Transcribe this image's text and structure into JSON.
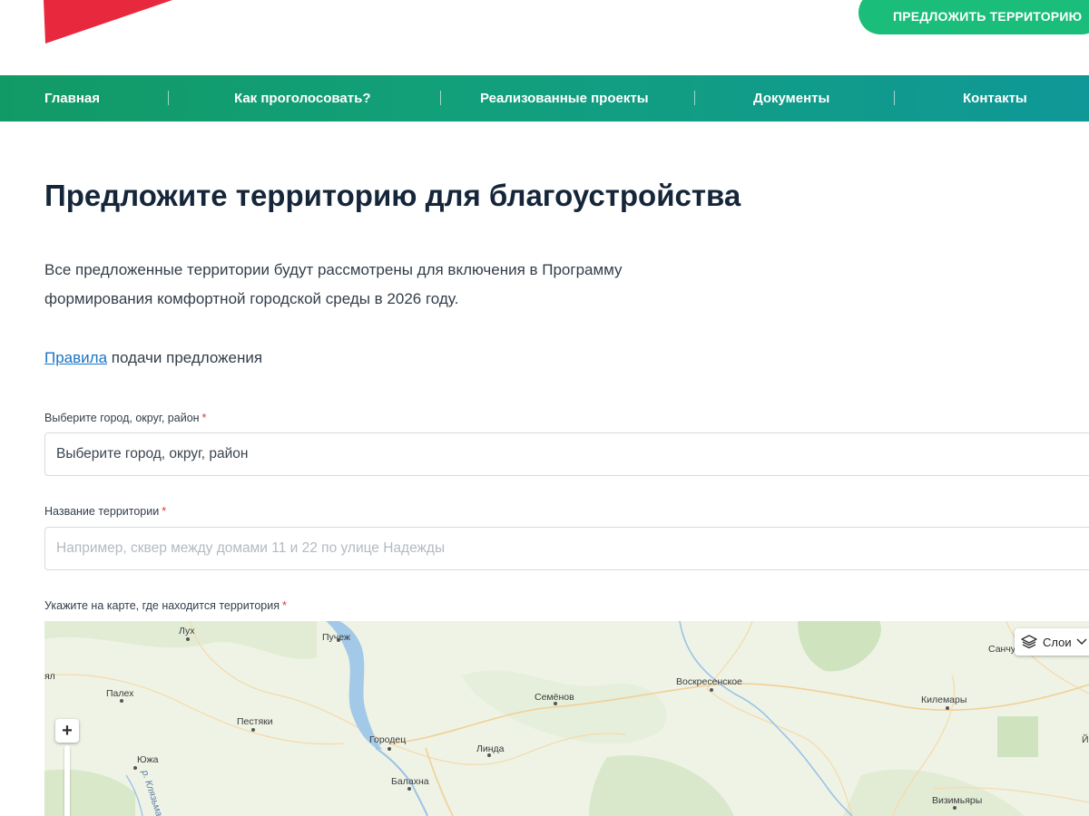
{
  "header": {
    "cta_label": "ПРЕДЛОЖИТЬ ТЕРРИТОРИЮ",
    "accent_color": "#1bbd7a",
    "logo_color": "#e8283c"
  },
  "nav": {
    "items": [
      {
        "label": "Главная"
      },
      {
        "label": "Как проголосовать?"
      },
      {
        "label": "Реализованные проекты"
      },
      {
        "label": "Документы"
      },
      {
        "label": "Контакты"
      }
    ],
    "gradient": [
      "#129a66",
      "#0f9897"
    ]
  },
  "main": {
    "title": "Предложите территорию для благоустройства",
    "intro_line1": "Все предложенные территории будут рассмотрены для включения в Программу",
    "intro_line2": "формирования комфортной городской среды в 2026 году.",
    "rules_link": "Правила",
    "rules_rest": "подачи предложения"
  },
  "form": {
    "city_label": "Выберите город, округ, район",
    "city_value": "Выберите город, округ, район",
    "name_label": "Название территории",
    "name_placeholder": "Например, сквер между домами 11 и 22 по улице Надежды",
    "map_label": "Укажите на карте, где находится территория",
    "required_mark": "*"
  },
  "map": {
    "zoom_in": "+",
    "layers_label": "Слои",
    "layers_icon": "layers-icon",
    "places": {
      "lukh": "Лух",
      "puchezh": "Пучеж",
      "ya": "ял",
      "palekh": "Палех",
      "pestyaki": "Пестяки",
      "semenov": "Семёнов",
      "voskresenskoe": "Воскресенское",
      "kilemary": "Килемары",
      "sanch": "Санчу",
      "yuzha": "Южа",
      "gorodets": "Городец",
      "linda": "Линда",
      "balakhna": "Балахна",
      "vizimyary": "Визимьяры",
      "river": "р. Клязьма",
      "y_edge": "Й"
    }
  }
}
